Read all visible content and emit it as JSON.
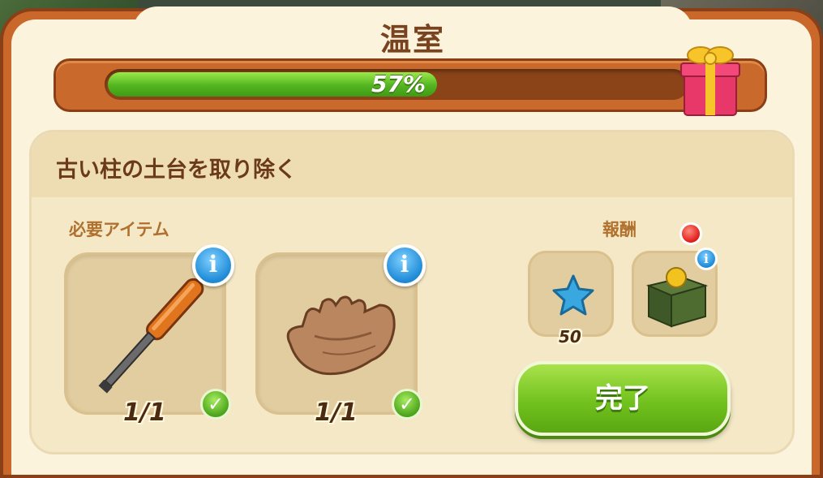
{
  "header": {
    "title": "温室",
    "progress_text": "57%",
    "progress_value": 0.57
  },
  "task": {
    "title": "古い柱の土台を取り除く",
    "required_label": "必要アイテム",
    "reward_label": "報酬",
    "items": [
      {
        "name": "screwdriver",
        "count": "1/1",
        "icon": "screwdriver-icon",
        "complete": true
      },
      {
        "name": "gloves",
        "count": "1/1",
        "icon": "leather-glove-icon",
        "complete": true
      }
    ],
    "rewards": [
      {
        "name": "blue-star",
        "count": "50",
        "icon": "blue-star-icon"
      },
      {
        "name": "coin-box",
        "count": "",
        "icon": "coin-box-icon"
      }
    ],
    "complete_label": "完了"
  },
  "colors": {
    "accent_green": "#72c21e",
    "frame_orange": "#c9682a",
    "info_blue": "#1e8ad6",
    "text_brown": "#6a3a1a"
  }
}
